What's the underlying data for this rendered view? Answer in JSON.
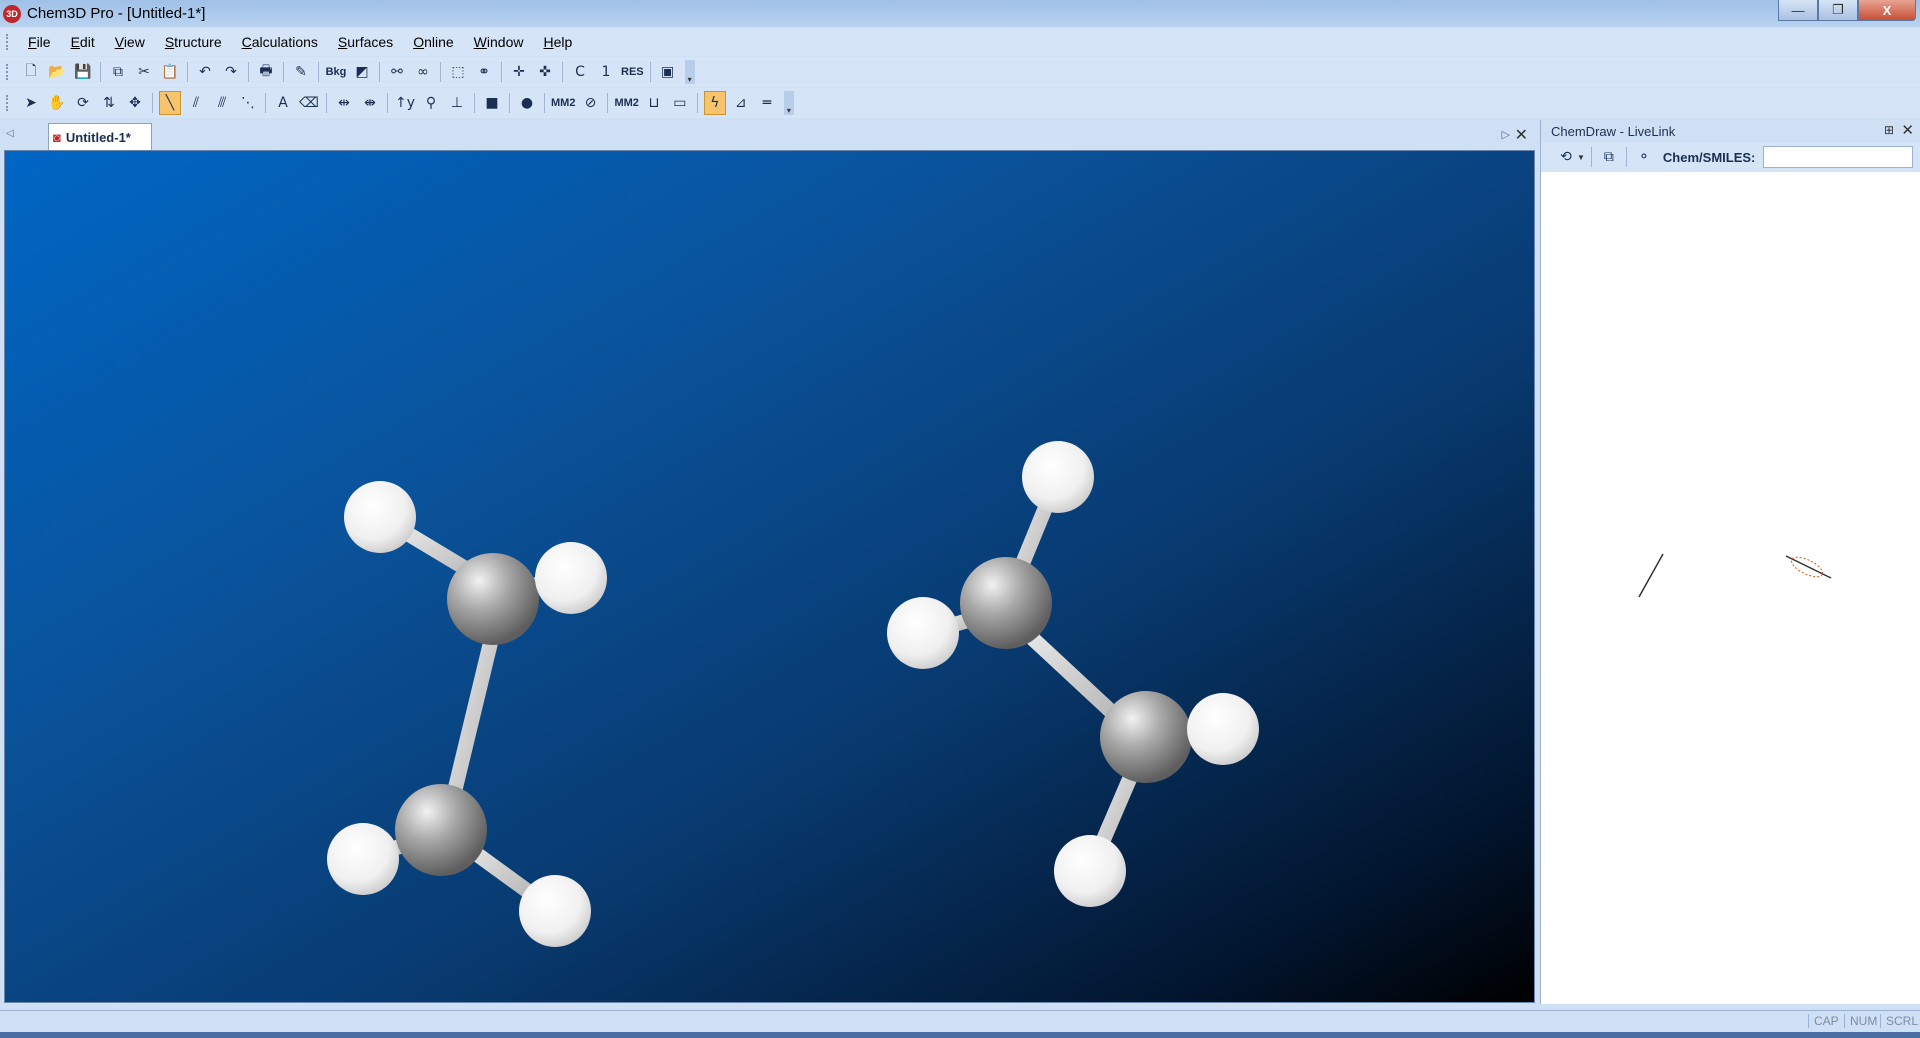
{
  "window": {
    "title": "Chem3D Pro - [Untitled-1*]",
    "app_icon": "3D",
    "controls": {
      "minimize": "—",
      "restore": "❐",
      "close": "X"
    }
  },
  "menu": [
    "File",
    "Edit",
    "View",
    "Structure",
    "Calculations",
    "Surfaces",
    "Online",
    "Window",
    "Help"
  ],
  "toolbar1": {
    "items": [
      {
        "icon": "new-document-icon",
        "glyph": "🗋"
      },
      {
        "icon": "open-folder-icon",
        "glyph": "📂"
      },
      {
        "icon": "save-icon",
        "glyph": "💾"
      },
      {
        "icon": "copy-icon",
        "glyph": "⧉"
      },
      {
        "icon": "cut-icon",
        "glyph": "✂"
      },
      {
        "icon": "paste-icon",
        "glyph": "📋"
      },
      {
        "icon": "undo-icon",
        "glyph": "↶"
      },
      {
        "icon": "redo-icon",
        "glyph": "↷"
      },
      {
        "icon": "print-icon",
        "glyph": "🖶"
      },
      {
        "icon": "color-picker-icon",
        "glyph": "✎"
      },
      {
        "icon": "background-color-icon",
        "glyph": "Bkg"
      },
      {
        "icon": "model-display-icon",
        "glyph": "◩"
      },
      {
        "icon": "stereo-view-icon",
        "glyph": "⚯"
      },
      {
        "icon": "stereo-pair-icon",
        "glyph": "∞"
      },
      {
        "icon": "box-icon",
        "glyph": "⬚"
      },
      {
        "icon": "link-icon",
        "glyph": "⚭"
      },
      {
        "icon": "move-x-icon",
        "glyph": "✛"
      },
      {
        "icon": "move-y-icon",
        "glyph": "✜"
      },
      {
        "icon": "carbon-label-icon",
        "glyph": "C"
      },
      {
        "icon": "serial-number-icon",
        "glyph": "1"
      },
      {
        "icon": "residue-icon",
        "glyph": "RES"
      },
      {
        "icon": "presentation-icon",
        "glyph": "▣"
      }
    ]
  },
  "toolbar2": {
    "items": [
      {
        "icon": "select-arrow-icon",
        "glyph": "➤"
      },
      {
        "icon": "hand-icon",
        "glyph": "✋"
      },
      {
        "icon": "rotate-icon",
        "glyph": "⟳"
      },
      {
        "icon": "rotate-z-icon",
        "glyph": "⇅"
      },
      {
        "icon": "translate-icon",
        "glyph": "✥"
      },
      {
        "icon": "single-bond-icon",
        "glyph": "╲",
        "active": true
      },
      {
        "icon": "double-bond-icon",
        "glyph": "⫽"
      },
      {
        "icon": "triple-bond-icon",
        "glyph": "⫻"
      },
      {
        "icon": "dummy-bond-icon",
        "glyph": "⋱"
      },
      {
        "icon": "text-tool-icon",
        "glyph": "A"
      },
      {
        "icon": "eraser-icon",
        "glyph": "⌫"
      },
      {
        "icon": "flip-horizontal-icon",
        "glyph": "⇹"
      },
      {
        "icon": "flip-vertical-icon",
        "glyph": "⇼"
      },
      {
        "icon": "rotate-axis-icon",
        "glyph": "↑y"
      },
      {
        "icon": "atom-tool-icon",
        "glyph": "⚲"
      },
      {
        "icon": "measure-tool-icon",
        "glyph": "⊥"
      },
      {
        "icon": "stop-icon",
        "glyph": "■"
      },
      {
        "icon": "green-dot-icon",
        "glyph": "●"
      },
      {
        "icon": "mm2-minimize-icon",
        "glyph": "MM2"
      },
      {
        "icon": "cancel-calc-icon",
        "glyph": "⊘"
      },
      {
        "icon": "mm2-dynamics-icon",
        "glyph": "MM2"
      },
      {
        "icon": "distance-icon",
        "glyph": "⊔"
      },
      {
        "icon": "angle-icon",
        "glyph": "▭"
      },
      {
        "icon": "energy-icon",
        "glyph": "ϟ",
        "active": true
      },
      {
        "icon": "charge-icon",
        "glyph": "⊿"
      },
      {
        "icon": "surface-icon",
        "glyph": "═"
      }
    ]
  },
  "document_tab": {
    "label": "Untitled-1*",
    "icon": "chem3d-doc-icon"
  },
  "viewport": {
    "molecules": [
      {
        "name": "ethylene-molecule-left"
      },
      {
        "name": "ethylene-molecule-right"
      }
    ]
  },
  "livelink": {
    "title": "ChemDraw - LiveLink",
    "smiles_label": "Chem/SMILES:",
    "smiles_value": ""
  },
  "statusbar": {
    "cap": "CAP",
    "num": "NUM",
    "scrl": "SCRL"
  },
  "colors": {
    "carbon": "#9a9a9a",
    "hydrogen": "#f4f4f4",
    "bond": "#d8d8d8",
    "background_light": "#0066c4",
    "background_dark": "#000000"
  }
}
